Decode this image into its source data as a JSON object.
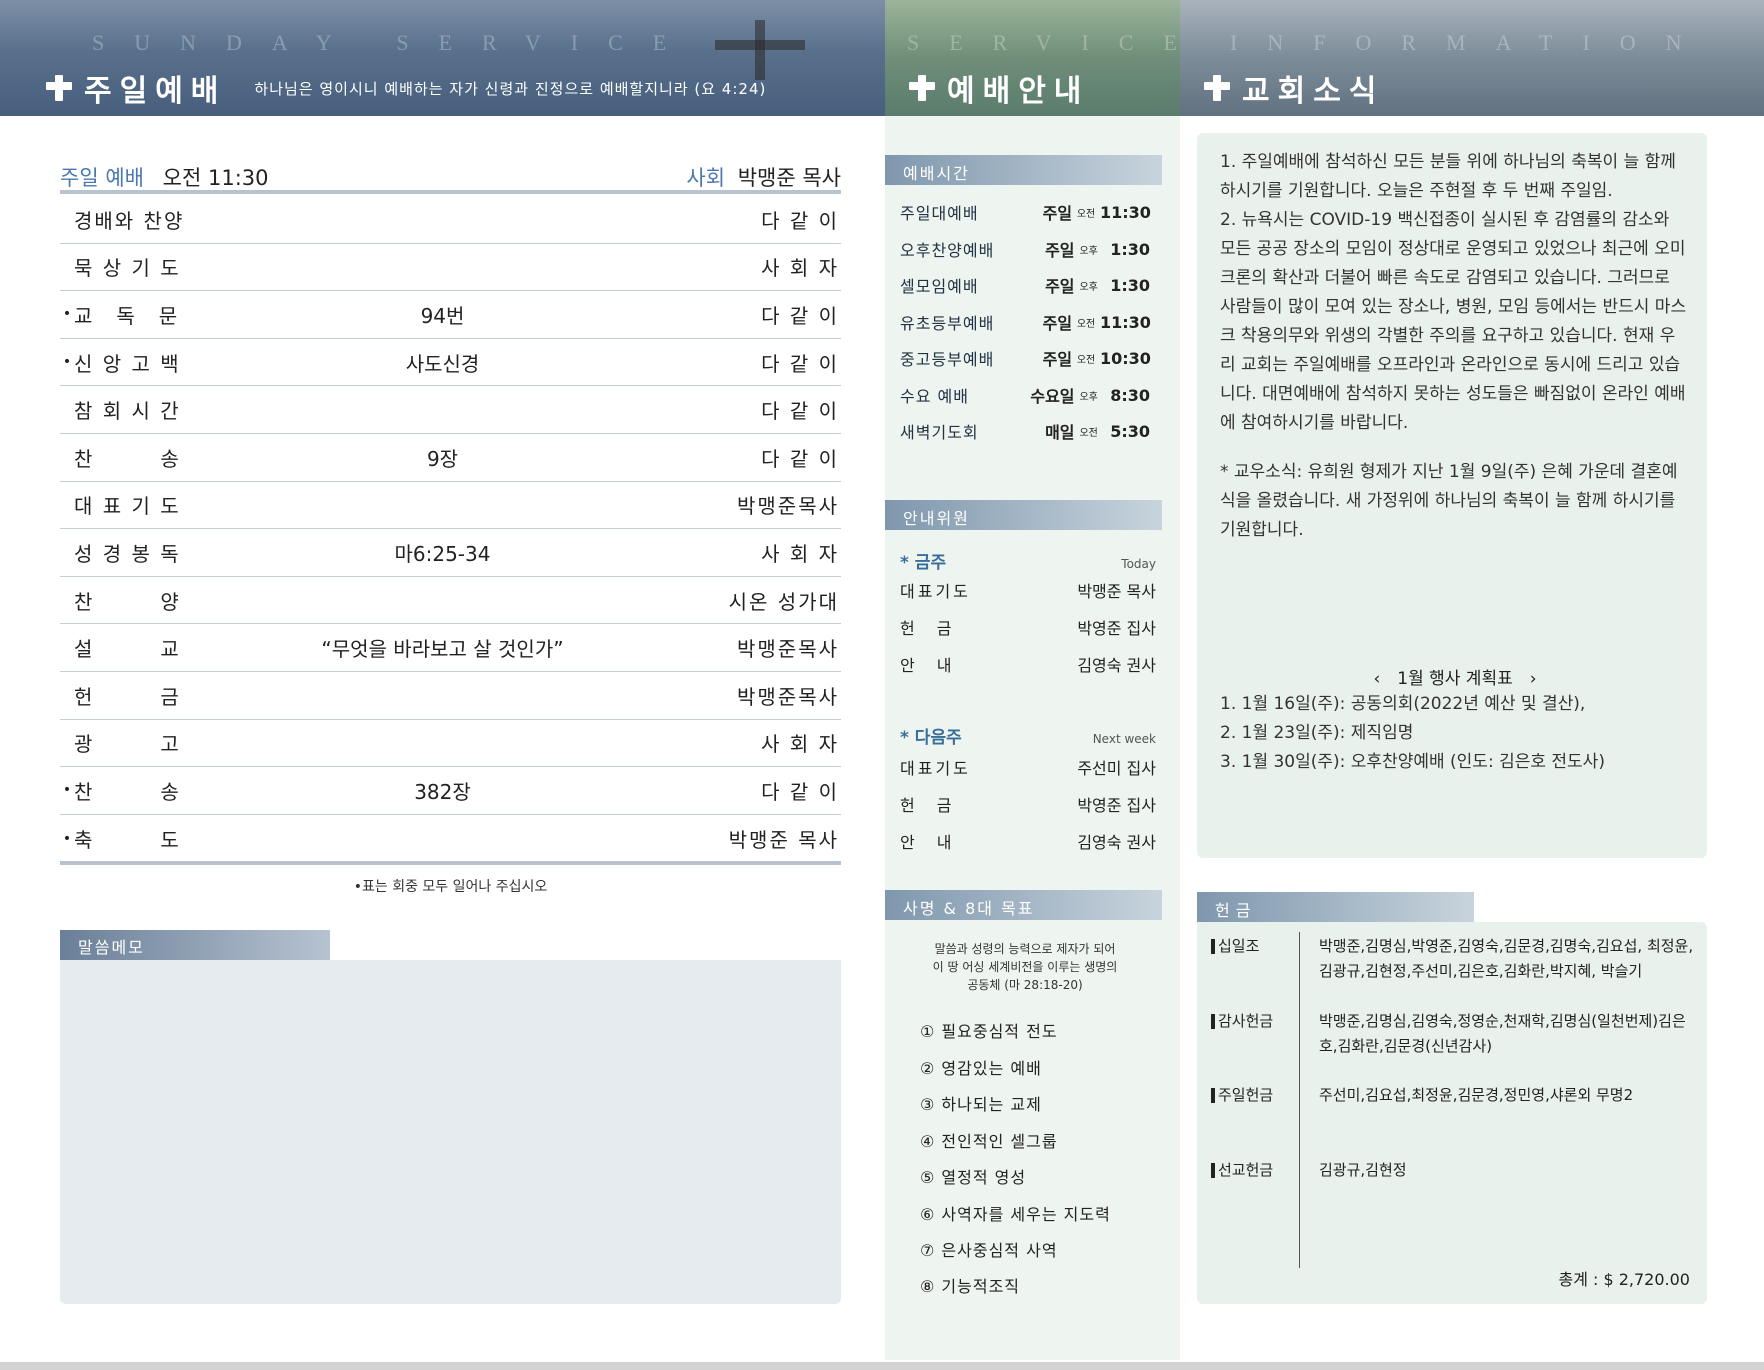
{
  "banners": {
    "sunday": {
      "ghost": "SUNDAY SERVICE",
      "title": "주일예배",
      "verse": "하나님은 영이시니 예배하는 자가 신령과 진정으로 예배할지니라 (요 4:24)"
    },
    "service": {
      "ghost": "SERVICE",
      "title": "예배안내"
    },
    "news": {
      "ghost": "INFORMATION",
      "title": "교회소식"
    }
  },
  "order": {
    "header_left_label": "주일 예배",
    "header_left_time": "오전 11:30",
    "header_right_label": "사회",
    "header_right_name": "박맹준 목사",
    "rows": [
      {
        "star": "",
        "item": "경배와 찬양",
        "mid": "",
        "who": "다 같 이"
      },
      {
        "star": "",
        "item": "묵 상 기 도",
        "mid": "",
        "who": "사 회 자"
      },
      {
        "star": "•",
        "item": "교　독　문",
        "mid": "94번",
        "who": "다 같 이"
      },
      {
        "star": "•",
        "item": "신 앙 고 백",
        "mid": "사도신경",
        "who": "다 같 이"
      },
      {
        "star": "",
        "item": "참 회 시 간",
        "mid": "",
        "who": "다 같 이"
      },
      {
        "star": "",
        "item": "찬　　　송",
        "mid": "9장",
        "who": "다 같 이"
      },
      {
        "star": "",
        "item": "대 표 기 도",
        "mid": "",
        "who": "박맹준목사"
      },
      {
        "star": "",
        "item": "성 경 봉 독",
        "mid": "마6:25-34",
        "who": "사 회 자"
      },
      {
        "star": "",
        "item": "찬　　　양",
        "mid": "",
        "who": "시온 성가대"
      },
      {
        "star": "",
        "item": "설　　　교",
        "mid": "“무엇을 바라보고 살 것인가”",
        "who": "박맹준목사"
      },
      {
        "star": "",
        "item": "헌　　　금",
        "mid": "",
        "who": "박맹준목사"
      },
      {
        "star": "",
        "item": "광　　　고",
        "mid": "",
        "who": "사 회 자"
      },
      {
        "star": "•",
        "item": "찬　　　송",
        "mid": "382장",
        "who": "다 같 이"
      },
      {
        "star": "•",
        "item": "축　　　도",
        "mid": "",
        "who": "박맹준 목사"
      }
    ],
    "stand_note": "•표는 회중 모두 일어나 주십시오"
  },
  "memo": {
    "label": "말씀메모"
  },
  "times": {
    "label": "예배시간",
    "rows": [
      {
        "name": "주일대예배",
        "day": "주일",
        "ampm": "오전",
        "time": "11:30"
      },
      {
        "name": "오후찬양예배",
        "day": "주일",
        "ampm": "오후",
        "time": "1:30"
      },
      {
        "name": "셀모임예배",
        "day": "주일",
        "ampm": "오후",
        "time": "1:30"
      },
      {
        "name": "유초등부예배",
        "day": "주일",
        "ampm": "오전",
        "time": "11:30"
      },
      {
        "name": "중고등부예배",
        "day": "주일",
        "ampm": "오전",
        "time": "10:30"
      },
      {
        "name": "수요 예배",
        "day": "수요일",
        "ampm": "오후",
        "time": "8:30"
      },
      {
        "name": "새벽기도회",
        "day": "매일",
        "ampm": "오전",
        "time": "5:30"
      }
    ]
  },
  "ushers": {
    "label": "안내위원",
    "this_week": {
      "label": "* 금주",
      "en": "Today",
      "rows": [
        {
          "role": "대표기도",
          "name": "박맹준 목사"
        },
        {
          "role": "헌　금",
          "name": "박영준 집사"
        },
        {
          "role": "안　내",
          "name": "김영숙 권사"
        }
      ]
    },
    "next_week": {
      "label": "* 다음주",
      "en": "Next week",
      "rows": [
        {
          "role": "대표기도",
          "name": "주선미 집사"
        },
        {
          "role": "헌　금",
          "name": "박영준 집사"
        },
        {
          "role": "안　내",
          "name": "김영숙 권사"
        }
      ]
    }
  },
  "mission": {
    "label": "사명 & 8대 목표",
    "text_1": "말씀과 성령의 능력으로 제자가 되어",
    "text_2": "이 땅 어싱 세계비전을 이루는 생명의",
    "text_3": "공동체 (마 28:18-20)",
    "goals": [
      "① 필요중심적 전도",
      "② 영감있는 예배",
      "③ 하나되는 교제",
      "④ 전인적인 셀그룹",
      "⑤ 열정적 영성",
      "⑥ 사역자를 세우는 지도력",
      "⑦ 은사중심적 사역",
      "⑧ 기능적조직"
    ]
  },
  "news": {
    "p1": "1. 주일예배에 참석하신 모든 분들 위에 하나님의 축복이 늘 함께 하시기를 기원합니다. 오늘은 주현절 후 두 번째 주일임.",
    "p2": "2. 뉴욕시는 COVID-19 백신접종이 실시된 후 감염률의 감소와 모든 공공 장소의 모임이 정상대로 운영되고 있었으나 최근에 오미크론의 확산과 더불어 빠른 속도로 감염되고 있습니다. 그러므로 사람들이 많이 모여 있는 장소나, 병원, 모임 등에서는 반드시 마스크 착용의무와 위생의 각별한 주의를 요구하고 있습니다. 현재 우리 교회는 주일예배를 오프라인과 온라인으로 동시에 드리고 있습니다. 대면예배에 참석하지 못하는 성도들은 빠짐없이 온라인 예배에 참여하시기를 바랍니다.",
    "p3": "* 교우소식: 유희원 형제가 지난 1월 9일(주) 은혜 가운데 결혼예식을 올렸습니다. 새 가정위에 하나님의 축복이 늘 함께 하시기를 기원합니다.",
    "plan_title": "‹　1월 행사 계획표　›",
    "plan": [
      "1. 1월 16일(주): 공동의회(2022년 예산 및 결산),",
      "2. 1월 23일(주): 제직임명",
      "3. 1월 30일(주): 오후찬양예배 (인도: 김은호 전도사)"
    ]
  },
  "offering": {
    "label": "헌금",
    "rows": [
      {
        "category": "십일조",
        "names": "박맹준,김명심,박영준,김영숙,김문경,김명숙,김요섭, 최정윤,김광규,김현정,주선미,김은호,김화란,박지혜, 박슬기"
      },
      {
        "category": "감사헌금",
        "names": "박맹준,김명심,김영숙,정영순,천재학,김명심(일천번제)김은호,김화란,김문경(신년감사)"
      },
      {
        "category": "주일헌금",
        "names": "주선미,김요섭,최정윤,김문경,정민영,샤론외 무명2"
      },
      {
        "category": "선교헌금",
        "names": "김광규,김현정"
      }
    ],
    "total": "총계 : $ 2,720.00"
  },
  "colors": {
    "accent": "#4a78b0",
    "mid_bg": "#eef4ef",
    "box_bg": "#e9f1ec",
    "memo_bg": "#e6ebf0"
  }
}
